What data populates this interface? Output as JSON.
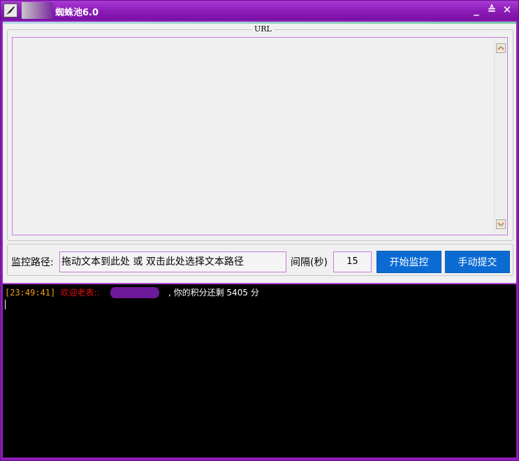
{
  "window": {
    "title": "蜘蛛池6.0",
    "controls": [
      "_",
      "≙",
      "✕"
    ]
  },
  "url_group": {
    "legend": "URL",
    "content": ""
  },
  "controls": {
    "path_label": "监控路径:",
    "path_value": "拖动文本到此处 或 双击此处选择文本路径",
    "interval_label": "间隔(秒)",
    "interval_value": "15",
    "start_button": "开始监控",
    "submit_button": "手动提交"
  },
  "console": {
    "lines": [
      {
        "timestamp": "[23:49:41]",
        "welcome": "欢迎老表::",
        "message": ", 你的积分还剩 5405 分"
      }
    ]
  },
  "colors": {
    "title_bar": "#8b1bb6",
    "button": "#0b6bd3",
    "timestamp": "#f0a020",
    "welcome": "#e01010",
    "console_bg": "#000000"
  },
  "icons": {
    "app": "paintbrush-icon",
    "scroll_up": "scroll-up-icon",
    "scroll_down": "scroll-down-icon"
  }
}
